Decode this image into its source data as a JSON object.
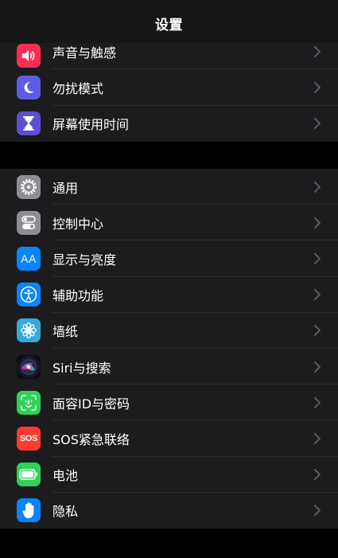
{
  "nav": {
    "title": "设置"
  },
  "colors": {
    "red": "#ff2d55",
    "purple": "#5e5ce6",
    "screen_time": "#5e4fd1",
    "gray": "#8e8e93",
    "blue": "#0a84ff",
    "teal": "#34aadc",
    "green": "#30d158",
    "sos_red": "#ff3b30"
  },
  "group1": {
    "items": [
      {
        "label": "声音与触感",
        "icon": "speaker-icon"
      },
      {
        "label": "勿扰模式",
        "icon": "moon-icon"
      },
      {
        "label": "屏幕使用时间",
        "icon": "hourglass-icon"
      }
    ]
  },
  "group2": {
    "items": [
      {
        "label": "通用",
        "icon": "gear-icon"
      },
      {
        "label": "控制中心",
        "icon": "toggles-icon"
      },
      {
        "label": "显示与亮度",
        "icon": "text-size-icon",
        "icon_text": "AA"
      },
      {
        "label": "辅助功能",
        "icon": "accessibility-icon"
      },
      {
        "label": "墙纸",
        "icon": "flower-icon"
      },
      {
        "label": "Siri与搜索",
        "icon": "siri-icon"
      },
      {
        "label": "面容ID与密码",
        "icon": "face-id-icon"
      },
      {
        "label": "SOS紧急联络",
        "icon": "sos-icon",
        "icon_text": "SOS"
      },
      {
        "label": "电池",
        "icon": "battery-icon"
      },
      {
        "label": "隐私",
        "icon": "hand-icon"
      }
    ]
  }
}
